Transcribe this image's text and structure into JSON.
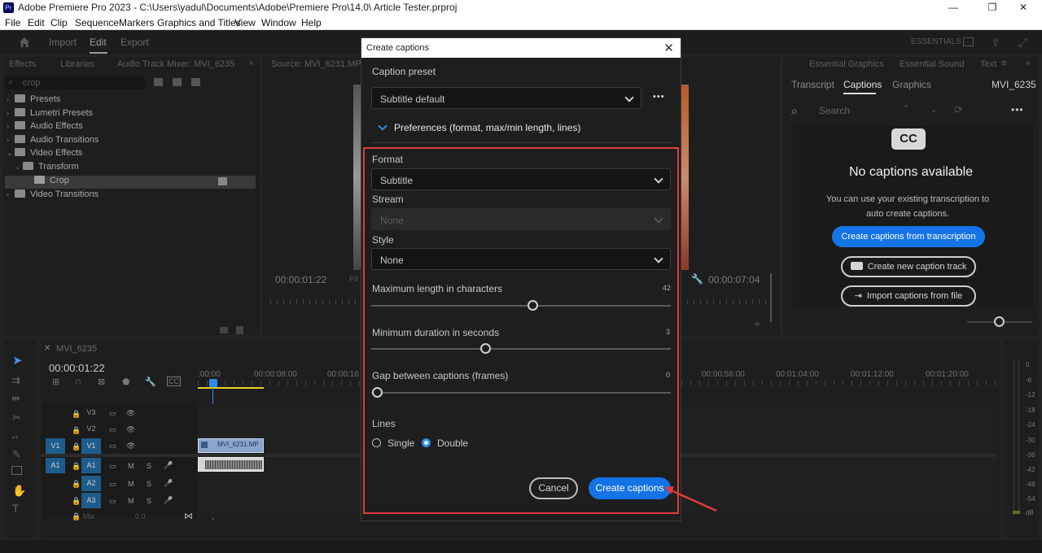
{
  "window": {
    "logo": "Pr",
    "title": "Adobe Premiere Pro 2023 - C:\\Users\\yadul\\Documents\\Adobe\\Premiere Pro\\14.0\\ Article Tester.prproj"
  },
  "menu": [
    "File",
    "Edit",
    "Clip",
    "Sequence",
    "Markers",
    "Graphics and Titles",
    "View",
    "Window",
    "Help"
  ],
  "workspace": {
    "tabs": [
      "Import",
      "Edit",
      "Export"
    ],
    "active": "Edit",
    "right_label": "ESSENTIALS"
  },
  "effects_panel": {
    "tabs": [
      "Effects",
      "Libraries",
      "Audio Track Mixer: MVI_6235"
    ],
    "search_value": "crop",
    "tree": [
      {
        "label": "Presets",
        "depth": 0,
        "expanded": false
      },
      {
        "label": "Lumetri Presets",
        "depth": 0,
        "expanded": false
      },
      {
        "label": "Audio Effects",
        "depth": 0,
        "expanded": false
      },
      {
        "label": "Audio Transitions",
        "depth": 0,
        "expanded": false
      },
      {
        "label": "Video Effects",
        "depth": 0,
        "expanded": true
      },
      {
        "label": "Transform",
        "depth": 1,
        "expanded": true
      },
      {
        "label": "Crop",
        "depth": 2,
        "selected": true
      },
      {
        "label": "Video Transitions",
        "depth": 0,
        "expanded": false
      }
    ]
  },
  "source_monitor": {
    "title": "Source: MVI_6231.MP4",
    "timecode_left": "00:00:01:22",
    "fit_label": "Fit",
    "timecode_right": "00:00:07:04"
  },
  "captions_panel": {
    "top_tabs": [
      "Essential Graphics",
      "Essential Sound",
      "Text"
    ],
    "tabs": [
      "Transcript",
      "Captions",
      "Graphics"
    ],
    "active_tab": "Captions",
    "sequence": "MVI_6235",
    "search_placeholder": "Search",
    "cc_badge": "CC",
    "empty_title": "No captions available",
    "empty_line1": "You can use your existing transcription to",
    "empty_line2": "auto create captions.",
    "btn_from_transcription": "Create captions from transcription",
    "btn_new_track": "Create new caption track",
    "btn_import": "Import captions from file"
  },
  "timeline": {
    "sequence_tab": "MVI_6235",
    "timecode": "00:00:01:22",
    "ruler": [
      ":00:00",
      "00:00:08:00",
      "00:00:16",
      "00:00:56:00",
      "00:01:04:00",
      "00:01:12:00",
      "00:01:20:00"
    ],
    "tracks": {
      "v3": "V3",
      "v2": "V2",
      "v1_src": "V1",
      "v1": "V1",
      "a1_src": "A1",
      "a1": "A1",
      "a2": "A2",
      "a3": "A3",
      "mix": "Mix",
      "mix_val": "0.0",
      "m": "M",
      "s": "S"
    },
    "clip_name": "MVI_6231.MP",
    "meter_labels": [
      "0",
      "-6",
      "-12",
      "-18",
      "-24",
      "-30",
      "-36",
      "-42",
      "-48",
      "-54",
      "dB"
    ]
  },
  "dialog": {
    "title": "Create captions",
    "preset_label": "Caption preset",
    "preset_value": "Subtitle default",
    "more": "•••",
    "preferences_label": "Preferences (format, max/min length, lines)",
    "format_label": "Format",
    "format_value": "Subtitle",
    "stream_label": "Stream",
    "stream_value": "None",
    "style_label": "Style",
    "style_value": "None",
    "max_len_label": "Maximum length in characters",
    "max_len_value": "42",
    "min_dur_label": "Minimum duration in seconds",
    "min_dur_value": "3",
    "gap_label": "Gap between captions (frames)",
    "gap_value": "0",
    "lines_label": "Lines",
    "lines_options": [
      "Single",
      "Double"
    ],
    "lines_selected": "Double",
    "cancel": "Cancel",
    "create": "Create captions"
  },
  "colors": {
    "accent": "#1473e6",
    "highlight": "#e03c3c",
    "track_select": "#1e5c8c"
  }
}
